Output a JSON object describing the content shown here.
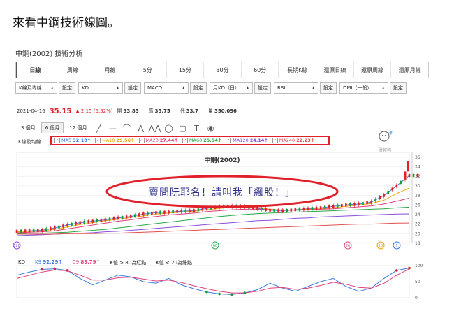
{
  "intro_text": "來看中鋼技術線圖。",
  "panel_title": "中鋼(2002) 技術分析",
  "tabs": [
    {
      "label": "日線",
      "active": true
    },
    {
      "label": "周線",
      "active": false
    },
    {
      "label": "月線",
      "active": false
    },
    {
      "label": "5分",
      "active": false
    },
    {
      "label": "15分",
      "active": false
    },
    {
      "label": "30分",
      "active": false
    },
    {
      "label": "60分",
      "active": false
    },
    {
      "label": "長期K線",
      "active": false
    },
    {
      "label": "還原日線",
      "active": false
    },
    {
      "label": "還原周線",
      "active": false
    },
    {
      "label": "還原月線",
      "active": false
    }
  ],
  "controls": [
    {
      "select": "K線及均線",
      "button": "設定"
    },
    {
      "select": "KD",
      "button": "設定"
    },
    {
      "select": "MACD",
      "button": "設定"
    },
    {
      "select": "月KD（日）",
      "button": "設定"
    },
    {
      "select": "RSI",
      "button": "設定"
    },
    {
      "select": "DMI（一般）",
      "button": "設定"
    }
  ],
  "quote": {
    "date": "2021-04-16",
    "price": "35.15",
    "change": "▲ 2.15 (6.52%)",
    "open_label": "開",
    "open": "33.85",
    "high_label": "高",
    "high": "35.75",
    "low_label": "低",
    "low": "33.7",
    "vol_label": "量",
    "vol": "350,096"
  },
  "range_tabs": [
    {
      "label": "3 個月",
      "active": false
    },
    {
      "label": "6 個月",
      "active": true
    },
    {
      "label": "12 個月",
      "active": false
    }
  ],
  "draw_tools": [
    "╱",
    "—",
    "⌒",
    "⋀",
    "⋀⋀",
    "◯",
    "▢",
    "T",
    "◉"
  ],
  "ma_section_label": "K線及均線",
  "ma_legend": [
    {
      "label": "MA5",
      "value": "32.18↑",
      "color": "#3b7be0"
    },
    {
      "label": "MA10",
      "value": "29.56↑",
      "color": "#f2a400"
    },
    {
      "label": "MA20",
      "value": "27.44↑",
      "color": "#e0407a"
    },
    {
      "label": "MA60",
      "value": "25.54↑",
      "color": "#2aa84a"
    },
    {
      "label": "MA120",
      "value": "24.14↑",
      "color": "#8a4ee0"
    },
    {
      "label": "MA240",
      "value": "22.23↑",
      "color": "#e05050"
    }
  ],
  "logo_text": "財報狗",
  "chart_title": "中鋼(2002)",
  "annotation": "賣問阮耶名！請叫我「飆股！」",
  "y_ticks": [
    "36",
    "34",
    "32",
    "30",
    "28",
    "26",
    "24",
    "22",
    "20",
    "18"
  ],
  "event_markers": [
    {
      "label": "120",
      "color": "#8a4ee0"
    },
    {
      "label": "60",
      "color": "#2aa84a"
    },
    {
      "label": "20",
      "color": "#e0407a"
    },
    {
      "label": "10",
      "color": "#f2a400"
    },
    {
      "label": "5",
      "color": "#3b7be0"
    }
  ],
  "kd": {
    "label": "KD",
    "k_label": "K9",
    "k_value": "92.29↑",
    "d_label": "D9",
    "d_value": "89.79↑",
    "note1": "K值 > 80為紅點",
    "note2": "K值 < 20為綠點",
    "y_ticks": [
      "100",
      "50",
      "0"
    ]
  },
  "chart_data": {
    "type": "line",
    "title": "中鋼(2002)",
    "ylim": [
      18,
      37
    ],
    "series": [
      {
        "name": "MA5",
        "values": [
          20.5,
          20.6,
          20.7,
          21.2,
          21.8,
          22.3,
          22.6,
          22.9,
          23.3,
          23.6,
          24.1,
          24.4,
          24.5,
          24.7,
          24.8,
          25.3,
          25.6,
          25.7,
          25.6,
          25.3,
          24.9,
          24.8,
          25.0,
          25.2,
          25.4,
          25.7,
          26.0,
          26.2,
          26.6,
          28.0,
          30.0,
          32.18
        ]
      },
      {
        "name": "MA10",
        "values": [
          20.4,
          20.5,
          20.6,
          20.9,
          21.4,
          21.9,
          22.3,
          22.7,
          23.0,
          23.4,
          23.7,
          24.1,
          24.3,
          24.5,
          24.7,
          25.0,
          25.3,
          25.5,
          25.5,
          25.4,
          25.1,
          24.9,
          24.9,
          25.1,
          25.2,
          25.4,
          25.7,
          26.0,
          26.3,
          27.0,
          28.4,
          29.56
        ]
      },
      {
        "name": "MA20",
        "values": [
          20.2,
          20.3,
          20.4,
          20.6,
          21.0,
          21.4,
          21.8,
          22.2,
          22.6,
          22.9,
          23.3,
          23.6,
          23.9,
          24.1,
          24.3,
          24.6,
          24.8,
          25.0,
          25.1,
          25.1,
          25.0,
          24.9,
          24.9,
          25.0,
          25.1,
          25.2,
          25.4,
          25.6,
          25.8,
          26.2,
          26.8,
          27.44
        ]
      },
      {
        "name": "MA60",
        "values": [
          20.0,
          20.1,
          20.1,
          20.2,
          20.3,
          20.5,
          20.7,
          20.9,
          21.2,
          21.5,
          21.8,
          22.1,
          22.4,
          22.7,
          23.0,
          23.3,
          23.6,
          23.8,
          24.0,
          24.2,
          24.3,
          24.4,
          24.5,
          24.6,
          24.7,
          24.8,
          24.9,
          25.0,
          25.1,
          25.2,
          25.4,
          25.54
        ]
      },
      {
        "name": "MA120",
        "values": [
          19.6,
          19.7,
          19.8,
          19.9,
          20.0,
          20.1,
          20.2,
          20.4,
          20.5,
          20.7,
          20.9,
          21.1,
          21.3,
          21.5,
          21.7,
          21.9,
          22.1,
          22.3,
          22.5,
          22.7,
          22.8,
          23.0,
          23.2,
          23.3,
          23.5,
          23.6,
          23.7,
          23.8,
          23.9,
          24.0,
          24.1,
          24.14
        ]
      },
      {
        "name": "MA240",
        "values": [
          19.9,
          19.9,
          19.9,
          19.9,
          20.0,
          20.0,
          20.0,
          20.1,
          20.1,
          20.2,
          20.3,
          20.4,
          20.5,
          20.6,
          20.7,
          20.8,
          20.9,
          21.0,
          21.1,
          21.2,
          21.3,
          21.4,
          21.5,
          21.6,
          21.7,
          21.8,
          21.9,
          22.0,
          22.0,
          22.1,
          22.2,
          22.23
        ]
      },
      {
        "name": "K9",
        "values": [
          70,
          80,
          88,
          90,
          85,
          60,
          40,
          55,
          70,
          65,
          50,
          45,
          60,
          40,
          28,
          18,
          12,
          10,
          15,
          25,
          45,
          30,
          20,
          35,
          50,
          60,
          35,
          20,
          30,
          60,
          85,
          92.29
        ]
      },
      {
        "name": "D9",
        "values": [
          60,
          70,
          80,
          86,
          84,
          70,
          55,
          55,
          62,
          64,
          58,
          52,
          55,
          47,
          37,
          28,
          20,
          15,
          15,
          20,
          30,
          32,
          26,
          30,
          38,
          48,
          42,
          32,
          30,
          45,
          70,
          89.79
        ]
      }
    ]
  }
}
